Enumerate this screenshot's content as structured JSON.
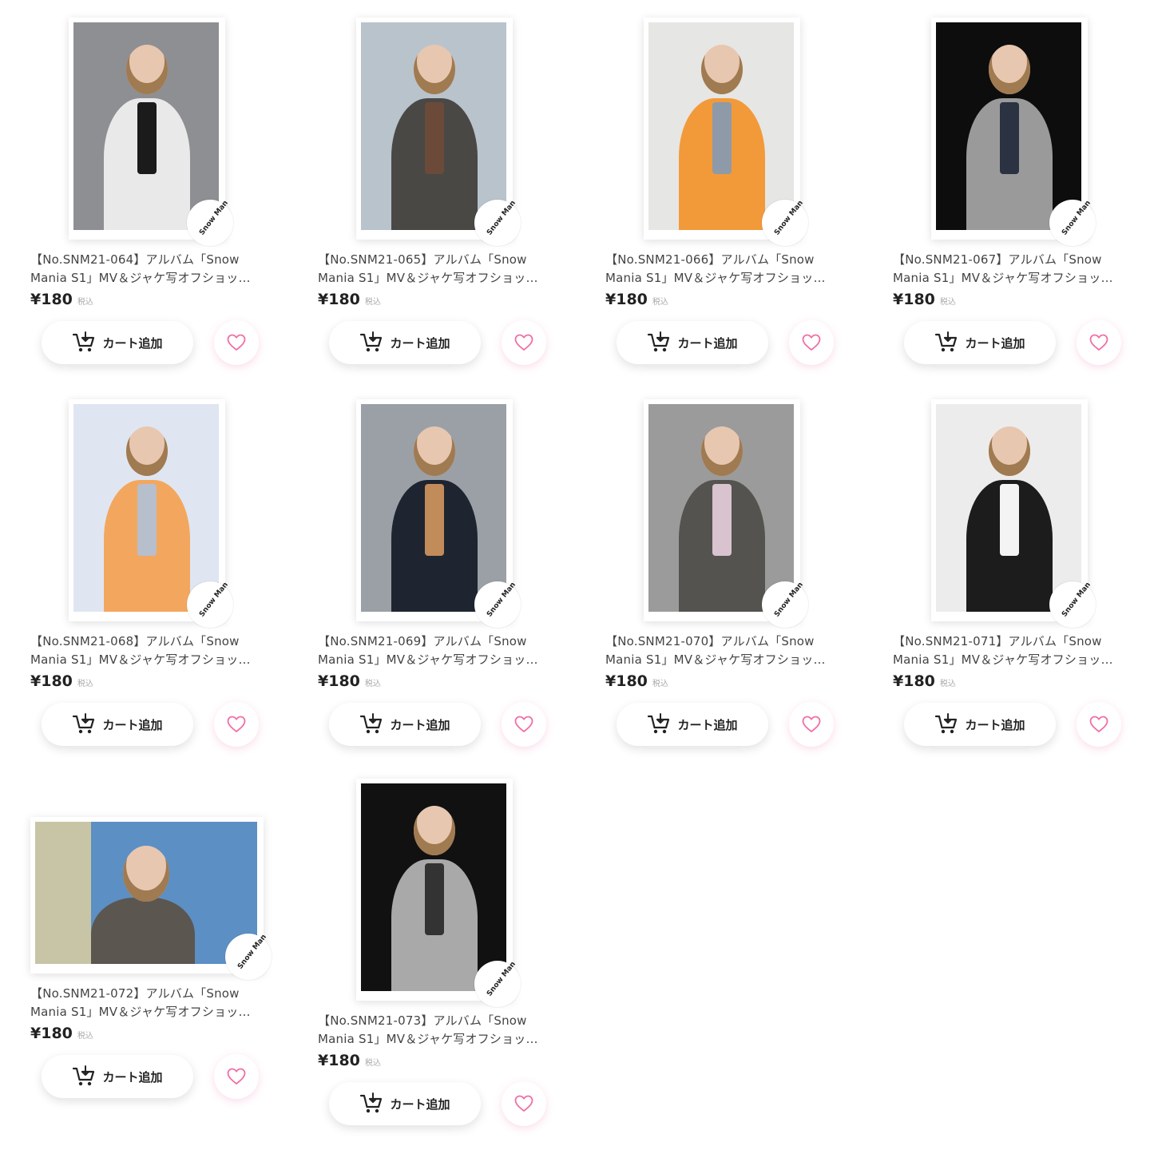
{
  "colors": {
    "heart": "#f06ea5",
    "text": "#444444",
    "price": "#222222",
    "tax": "#aaaaaa"
  },
  "stamp_label": "Snow Man",
  "products": [
    {
      "title_line1": "【No.SNM21-064】アルバム「Snow",
      "title_line2": "Mania S1」MV＆ジャケ写オフショッ…",
      "price": "¥180",
      "tax": "税込",
      "cart_label": "カート追加",
      "orientation": "portrait",
      "scene": {
        "bg": "#8e8f92",
        "jacket": "#e9e9ea",
        "accent": "#1b1b1b"
      }
    },
    {
      "title_line1": "【No.SNM21-065】アルバム「Snow",
      "title_line2": "Mania S1」MV＆ジャケ写オフショッ…",
      "price": "¥180",
      "tax": "税込",
      "cart_label": "カート追加",
      "orientation": "portrait",
      "scene": {
        "bg": "#b9c3cc",
        "jacket": "#4a4845",
        "accent": "#6b4a3a"
      }
    },
    {
      "title_line1": "【No.SNM21-066】アルバム「Snow",
      "title_line2": "Mania S1」MV＆ジャケ写オフショッ…",
      "price": "¥180",
      "tax": "税込",
      "cart_label": "カート追加",
      "orientation": "portrait",
      "scene": {
        "bg": "#e6e6e4",
        "jacket": "#f29a3a",
        "accent": "#8e9aa8"
      }
    },
    {
      "title_line1": "【No.SNM21-067】アルバム「Snow",
      "title_line2": "Mania S1」MV＆ジャケ写オフショッ…",
      "price": "¥180",
      "tax": "税込",
      "cart_label": "カート追加",
      "orientation": "portrait",
      "scene": {
        "bg": "#0d0d0d",
        "jacket": "#9a9a9a",
        "accent": "#2b3242"
      }
    },
    {
      "title_line1": "【No.SNM21-068】アルバム「Snow",
      "title_line2": "Mania S1」MV＆ジャケ写オフショッ…",
      "price": "¥180",
      "tax": "税込",
      "cart_label": "カート追加",
      "orientation": "portrait",
      "scene": {
        "bg": "#dfe6f2",
        "jacket": "#f3a75e",
        "accent": "#b7bfcc"
      }
    },
    {
      "title_line1": "【No.SNM21-069】アルバム「Snow",
      "title_line2": "Mania S1」MV＆ジャケ写オフショッ…",
      "price": "¥180",
      "tax": "税込",
      "cart_label": "カート追加",
      "orientation": "portrait",
      "scene": {
        "bg": "#9aa0a6",
        "jacket": "#1e2530",
        "accent": "#c28b5a"
      }
    },
    {
      "title_line1": "【No.SNM21-070】アルバム「Snow",
      "title_line2": "Mania S1」MV＆ジャケ写オフショッ…",
      "price": "¥180",
      "tax": "税込",
      "cart_label": "カート追加",
      "orientation": "portrait",
      "scene": {
        "bg": "#9b9b9b",
        "jacket": "#55534f",
        "accent": "#d9c3cf"
      }
    },
    {
      "title_line1": "【No.SNM21-071】アルバム「Snow",
      "title_line2": "Mania S1」MV＆ジャケ写オフショッ…",
      "price": "¥180",
      "tax": "税込",
      "cart_label": "カート追加",
      "orientation": "portrait",
      "scene": {
        "bg": "#ececec",
        "jacket": "#1c1c1c",
        "accent": "#f4f4f4"
      }
    },
    {
      "title_line1": "【No.SNM21-072】アルバム「Snow",
      "title_line2": "Mania S1」MV＆ジャケ写オフショッ…",
      "price": "¥180",
      "tax": "税込",
      "cart_label": "カート追加",
      "orientation": "landscape",
      "scene": {
        "bg": "#5c8fc4",
        "jacket": "#5b5650",
        "accent": "#e2d29e"
      }
    },
    {
      "title_line1": "【No.SNM21-073】アルバム「Snow",
      "title_line2": "Mania S1」MV＆ジャケ写オフショッ…",
      "price": "¥180",
      "tax": "税込",
      "cart_label": "カート追加",
      "orientation": "portrait",
      "scene": {
        "bg": "#111111",
        "jacket": "#a9a9a9",
        "accent": "#333333"
      }
    }
  ]
}
